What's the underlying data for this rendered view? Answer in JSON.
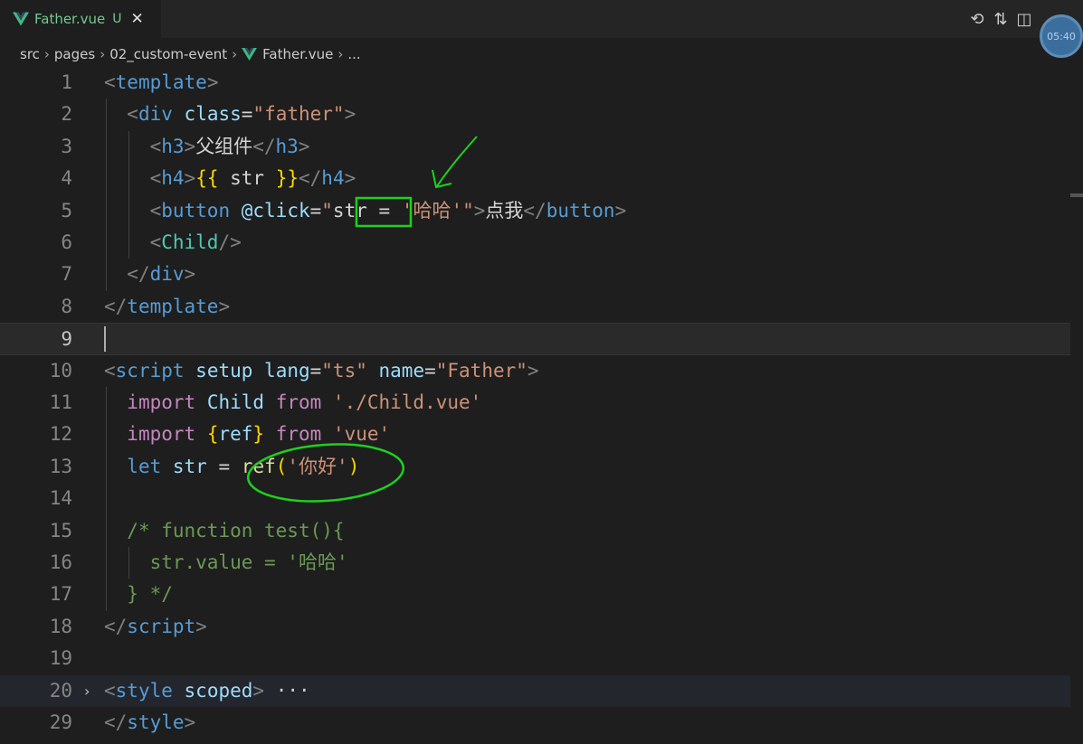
{
  "tab": {
    "filename": "Father.vue",
    "status": "U",
    "close_icon": "close-icon",
    "logo_icon": "vue-logo-icon"
  },
  "actions": {
    "history_icon": "timeline-icon",
    "compare_icon": "compare-changes-icon",
    "split_icon": "split-editor-icon"
  },
  "timer": {
    "time": "05:40"
  },
  "breadcrumb": {
    "items": [
      "src",
      "pages",
      "02_custom-event",
      "Father.vue",
      "..."
    ]
  },
  "editor": {
    "cursor_line": "9",
    "lines": [
      {
        "num": "1",
        "tokens": [
          [
            "<",
            "br"
          ],
          [
            "template",
            "tag"
          ],
          [
            ">",
            "br"
          ]
        ]
      },
      {
        "num": "2",
        "tokens": [
          [
            "  ",
            ""
          ],
          [
            "<",
            "br"
          ],
          [
            "div",
            "tag"
          ],
          [
            " ",
            ""
          ],
          [
            "class",
            "attr"
          ],
          [
            "=",
            "txt"
          ],
          [
            "\"father\"",
            "str"
          ],
          [
            ">",
            "br"
          ]
        ]
      },
      {
        "num": "3",
        "tokens": [
          [
            "    ",
            ""
          ],
          [
            "<",
            "br"
          ],
          [
            "h3",
            "tag"
          ],
          [
            ">",
            "br"
          ],
          [
            "父组件",
            "txt"
          ],
          [
            "</",
            "br"
          ],
          [
            "h3",
            "tag"
          ],
          [
            ">",
            "br"
          ]
        ]
      },
      {
        "num": "4",
        "tokens": [
          [
            "    ",
            ""
          ],
          [
            "<",
            "br"
          ],
          [
            "h4",
            "tag"
          ],
          [
            ">",
            "br"
          ],
          [
            "{{",
            "mus"
          ],
          [
            " str ",
            "txt"
          ],
          [
            "}}",
            "mus"
          ],
          [
            "</",
            "br"
          ],
          [
            "h4",
            "tag"
          ],
          [
            ">",
            "br"
          ]
        ]
      },
      {
        "num": "5",
        "tokens": [
          [
            "    ",
            ""
          ],
          [
            "<",
            "br"
          ],
          [
            "button",
            "tag"
          ],
          [
            " ",
            ""
          ],
          [
            "@click",
            "attr"
          ],
          [
            "=",
            "txt"
          ],
          [
            "\"",
            "str"
          ],
          [
            "str",
            "txt"
          ],
          [
            " = ",
            "txt"
          ],
          [
            "'哈哈'",
            "str"
          ],
          [
            "\"",
            "str"
          ],
          [
            ">",
            "br"
          ],
          [
            "点我",
            "txt"
          ],
          [
            "</",
            "br"
          ],
          [
            "button",
            "tag"
          ],
          [
            ">",
            "br"
          ]
        ]
      },
      {
        "num": "6",
        "tokens": [
          [
            "    ",
            ""
          ],
          [
            "<",
            "br"
          ],
          [
            "Child",
            "cls"
          ],
          [
            "/>",
            "br"
          ]
        ]
      },
      {
        "num": "7",
        "tokens": [
          [
            "  ",
            ""
          ],
          [
            "</",
            "br"
          ],
          [
            "div",
            "tag"
          ],
          [
            ">",
            "br"
          ]
        ]
      },
      {
        "num": "8",
        "tokens": [
          [
            "</",
            "br"
          ],
          [
            "template",
            "tag"
          ],
          [
            ">",
            "br"
          ]
        ]
      },
      {
        "num": "9",
        "tokens": []
      },
      {
        "num": "10",
        "tokens": [
          [
            "<",
            "br"
          ],
          [
            "script",
            "tag"
          ],
          [
            " ",
            ""
          ],
          [
            "setup",
            "attr"
          ],
          [
            " ",
            ""
          ],
          [
            "lang",
            "attr"
          ],
          [
            "=",
            "txt"
          ],
          [
            "\"ts\"",
            "str"
          ],
          [
            " ",
            ""
          ],
          [
            "name",
            "attr"
          ],
          [
            "=",
            "txt"
          ],
          [
            "\"Father\"",
            "str"
          ],
          [
            ">",
            "br"
          ]
        ]
      },
      {
        "num": "11",
        "tokens": [
          [
            "  ",
            ""
          ],
          [
            "import",
            "kw"
          ],
          [
            " ",
            ""
          ],
          [
            "Child",
            "ident"
          ],
          [
            " ",
            ""
          ],
          [
            "from",
            "kw"
          ],
          [
            " ",
            ""
          ],
          [
            "'./Child.vue'",
            "str"
          ]
        ]
      },
      {
        "num": "12",
        "tokens": [
          [
            "  ",
            ""
          ],
          [
            "import",
            "kw"
          ],
          [
            " ",
            ""
          ],
          [
            "{",
            "mus"
          ],
          [
            "ref",
            "ident"
          ],
          [
            "}",
            "mus"
          ],
          [
            " ",
            ""
          ],
          [
            "from",
            "kw"
          ],
          [
            " ",
            ""
          ],
          [
            "'vue'",
            "str"
          ]
        ]
      },
      {
        "num": "13",
        "tokens": [
          [
            "  ",
            ""
          ],
          [
            "let",
            "tag"
          ],
          [
            " ",
            ""
          ],
          [
            "str",
            "ident"
          ],
          [
            " ",
            ""
          ],
          [
            "=",
            "txt"
          ],
          [
            " ",
            ""
          ],
          [
            "ref",
            "fn"
          ],
          [
            "(",
            "mus"
          ],
          [
            "'你好'",
            "str"
          ],
          [
            ")",
            "mus"
          ]
        ]
      },
      {
        "num": "14",
        "tokens": []
      },
      {
        "num": "15",
        "tokens": [
          [
            "  ",
            ""
          ],
          [
            "/* function test(){",
            "com"
          ]
        ]
      },
      {
        "num": "16",
        "tokens": [
          [
            "    ",
            ""
          ],
          [
            "str.value = '哈哈'",
            "com"
          ]
        ]
      },
      {
        "num": "17",
        "tokens": [
          [
            "  ",
            ""
          ],
          [
            "} */",
            "com"
          ]
        ]
      },
      {
        "num": "18",
        "tokens": [
          [
            "</",
            "br"
          ],
          [
            "script",
            "tag"
          ],
          [
            ">",
            "br"
          ]
        ]
      },
      {
        "num": "19",
        "tokens": []
      },
      {
        "num": "20",
        "tokens": [
          [
            "<",
            "br"
          ],
          [
            "style",
            "tag"
          ],
          [
            " ",
            ""
          ],
          [
            "scoped",
            "attr"
          ],
          [
            ">",
            "br"
          ],
          [
            " ",
            ""
          ],
          [
            "···",
            "dots"
          ]
        ],
        "folded": true
      },
      {
        "num": "29",
        "tokens": [
          [
            "</",
            "br"
          ],
          [
            "style",
            "tag"
          ],
          [
            ">",
            "br"
          ]
        ]
      }
    ]
  },
  "colors": {
    "background": "#1e1e1e",
    "annotation_green": "#1ed01e",
    "vue_green": "#41b883",
    "modified_green": "#73c991"
  }
}
